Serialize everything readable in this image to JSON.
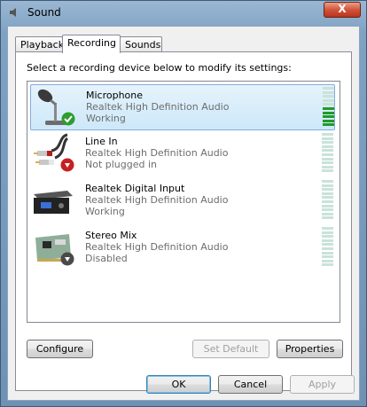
{
  "window": {
    "title": "Sound",
    "close_label": "X"
  },
  "tabs": [
    {
      "label": "Playback"
    },
    {
      "label": "Recording"
    },
    {
      "label": "Sounds"
    }
  ],
  "instruction": "Select a recording device below to modify its settings:",
  "devices": [
    {
      "name": "Microphone",
      "driver": "Realtek High Definition Audio",
      "status": "Working",
      "icon": "microphone-icon",
      "badge": "default-check-icon",
      "level_bars": 5
    },
    {
      "name": "Line In",
      "driver": "Realtek High Definition Audio",
      "status": "Not plugged in",
      "icon": "rca-cable-icon",
      "badge": "down-arrow-red-icon",
      "level_bars": 0
    },
    {
      "name": "Realtek Digital Input",
      "driver": "Realtek High Definition Audio",
      "status": "Working",
      "icon": "digital-input-box-icon",
      "badge": "",
      "level_bars": 0
    },
    {
      "name": "Stereo Mix",
      "driver": "Realtek High Definition Audio",
      "status": "Disabled",
      "icon": "sound-card-icon",
      "badge": "down-arrow-gray-icon",
      "level_bars": 0
    }
  ],
  "buttons": {
    "configure": "Configure",
    "set_default": "Set Default",
    "properties": "Properties",
    "ok": "OK",
    "cancel": "Cancel",
    "apply": "Apply"
  },
  "colors": {
    "meter_on": "#1f9a2a",
    "meter_off": "#c9e3da",
    "selection": "#cde8f9"
  }
}
